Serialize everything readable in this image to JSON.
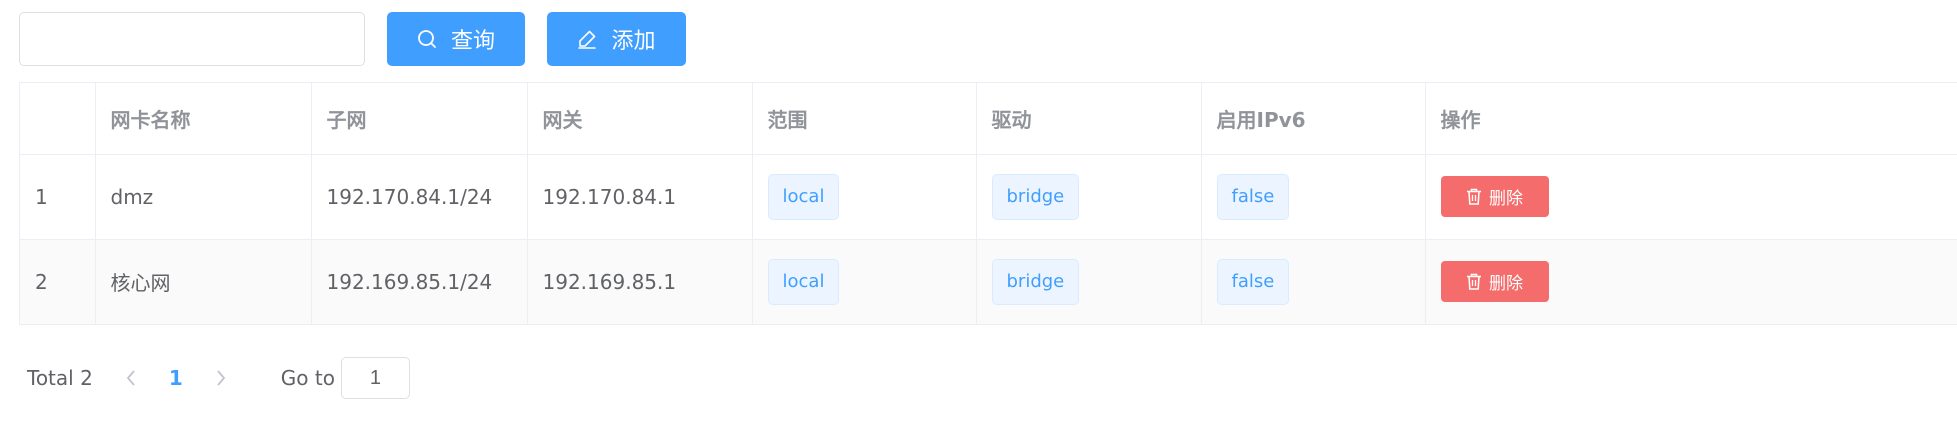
{
  "toolbar": {
    "search_value": "",
    "search_placeholder": "",
    "search_button_label": "查询",
    "add_button_label": "添加",
    "primary_color": "#409eff"
  },
  "table": {
    "headers": [
      "",
      "网卡名称",
      "子网",
      "网关",
      "范围",
      "驱动",
      "启用IPv6",
      "操作"
    ],
    "rows": [
      {
        "index": "1",
        "name": "dmz",
        "subnet": "192.170.84.1/24",
        "gateway": "192.170.84.1",
        "scope": "local",
        "driver": "bridge",
        "ipv6": "false",
        "action": "删除"
      },
      {
        "index": "2",
        "name": "核心网",
        "subnet": "192.169.85.1/24",
        "gateway": "192.169.85.1",
        "scope": "local",
        "driver": "bridge",
        "ipv6": "false",
        "action": "删除"
      }
    ],
    "delete_color": "#f56c6c"
  },
  "pagination": {
    "total_label": "Total 2",
    "current_page": "1",
    "goto_label": "Go to",
    "goto_value": "1"
  },
  "icons": {
    "search": "search-icon",
    "add": "edit-icon",
    "delete": "trash-icon",
    "prev": "chevron-left-icon",
    "next": "chevron-right-icon"
  }
}
